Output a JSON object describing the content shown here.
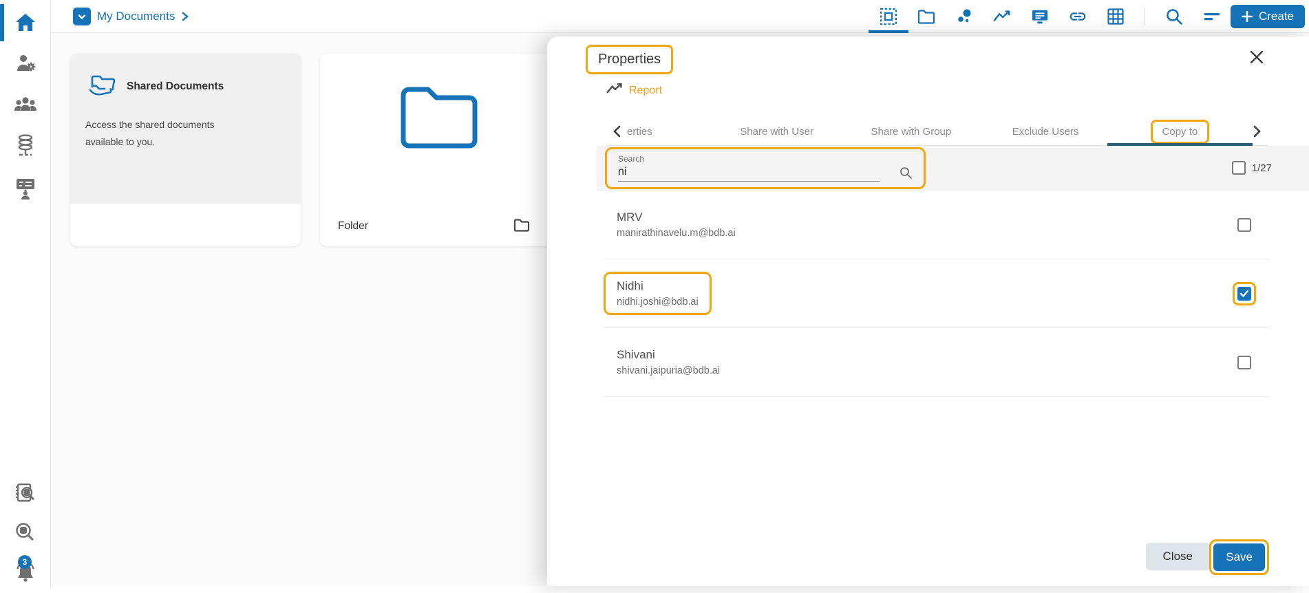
{
  "colors": {
    "accent_blue": "#1673b8",
    "highlight_orange": "#f0a811",
    "report_orange": "#f5a021",
    "active_tab_underline": "#2b5e76"
  },
  "sidebar": {
    "icons": [
      "home",
      "user-settings",
      "user-groups",
      "data-server",
      "trainer-board",
      "document-search",
      "data-search",
      "notifications"
    ],
    "notification_badge": "3"
  },
  "topbar": {
    "breadcrumb_label": "My Documents",
    "toolbar_icons": [
      "dashboard-select",
      "folder",
      "cluster-dots",
      "line-chart",
      "monitor-list",
      "link",
      "grid-table",
      "search",
      "sort-filter"
    ],
    "active_toolbar_icon": "dashboard-select",
    "create_label": "Create"
  },
  "main": {
    "shared_card": {
      "title": "Shared Documents",
      "description": "Access the shared documents available to you."
    },
    "folder_card": {
      "label": "Folder"
    }
  },
  "panel": {
    "title": "Properties",
    "entity_label": "Report",
    "entity_icon": "line-chart-icon",
    "tabs": [
      "erties",
      "Share with User",
      "Share with Group",
      "Exclude Users",
      "Copy to"
    ],
    "active_tab": "Copy to",
    "search": {
      "label": "Search",
      "value": "ni"
    },
    "counter": "1/27",
    "counter_checked": false,
    "users": [
      {
        "name": "MRV",
        "email": "manirathinavelu.m@bdb.ai",
        "checked": false,
        "highlighted": false
      },
      {
        "name": "Nidhi",
        "email": "nidhi.joshi@bdb.ai",
        "checked": true,
        "highlighted": true
      },
      {
        "name": "Shivani",
        "email": "shivani.jaipuria@bdb.ai",
        "checked": false,
        "highlighted": false
      }
    ],
    "close_label": "Close",
    "save_label": "Save"
  }
}
